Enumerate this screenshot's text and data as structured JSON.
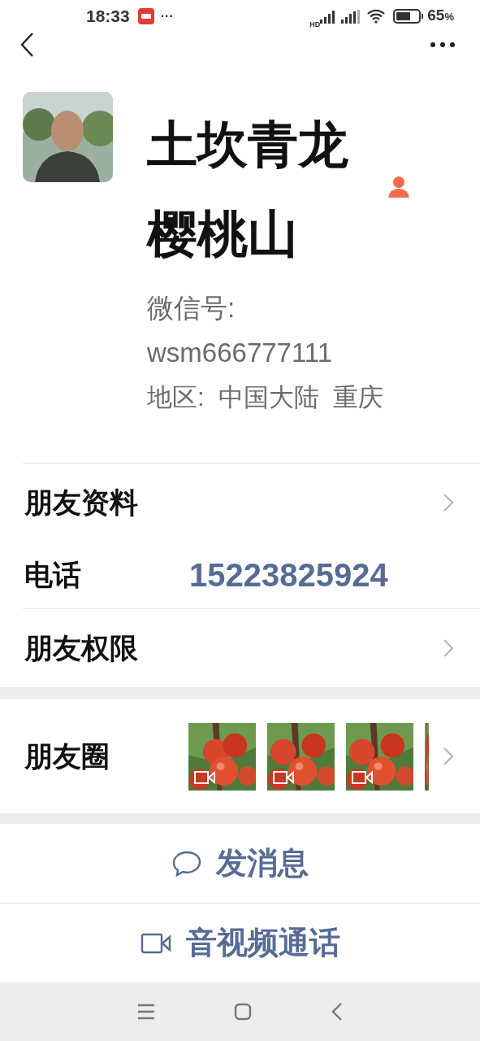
{
  "status_bar": {
    "time": "18:33",
    "more": "···",
    "network": "HD",
    "battery": "65",
    "battery_unit": "%"
  },
  "profile": {
    "name": "土坎青龙樱桃山",
    "wechat_id_label": "微信号:",
    "wechat_id": "wsm666777111",
    "region": "地区:  中国大陆  重庆"
  },
  "rows": [
    {
      "kind": "link",
      "label": "朋友资料"
    },
    {
      "kind": "phone",
      "label": "电话",
      "value": "15223825924"
    },
    {
      "kind": "link",
      "label": "朋友权限"
    }
  ],
  "moments": {
    "label": "朋友圈",
    "thumbs": [
      {
        "kind": "video"
      },
      {
        "kind": "video"
      },
      {
        "kind": "video"
      },
      {
        "kind": "partial"
      }
    ]
  },
  "actions": [
    {
      "kind": "message",
      "label": "发消息"
    },
    {
      "kind": "call",
      "label": "音视频通话"
    }
  ]
}
